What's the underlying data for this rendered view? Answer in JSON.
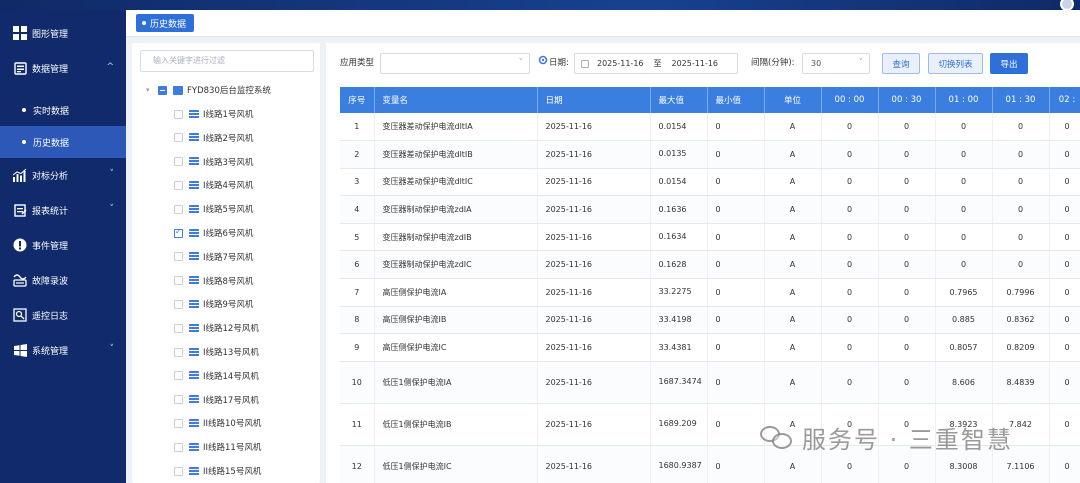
{
  "sidebar": {
    "items": [
      {
        "label": "图形管理",
        "icon": "grid-icon"
      },
      {
        "label": "数据管理",
        "icon": "database-icon",
        "expanded": true,
        "children": [
          {
            "label": "实时数据"
          },
          {
            "label": "历史数据",
            "active": true
          }
        ]
      },
      {
        "label": "对标分析",
        "icon": "bar-chart-icon"
      },
      {
        "label": "报表统计",
        "icon": "report-icon"
      },
      {
        "label": "事件管理",
        "icon": "alert-icon"
      },
      {
        "label": "故障录波",
        "icon": "wave-icon"
      },
      {
        "label": "遥控日志",
        "icon": "log-icon"
      },
      {
        "label": "系统管理",
        "icon": "windows-icon"
      }
    ]
  },
  "tab": {
    "label": "历史数据"
  },
  "tree": {
    "search_placeholder": "输入关键字进行过滤",
    "root": "FYD830后台监控系统",
    "nodes": [
      {
        "label": "I线路1号风机",
        "checked": false
      },
      {
        "label": "I线路2号风机",
        "checked": false
      },
      {
        "label": "I线路3号风机",
        "checked": false
      },
      {
        "label": "I线路4号风机",
        "checked": false
      },
      {
        "label": "I线路5号风机",
        "checked": false
      },
      {
        "label": "I线路6号风机",
        "checked": true
      },
      {
        "label": "I线路7号风机",
        "checked": false
      },
      {
        "label": "I线路8号风机",
        "checked": false
      },
      {
        "label": "I线路9号风机",
        "checked": false
      },
      {
        "label": "I线路12号风机",
        "checked": false
      },
      {
        "label": "I线路13号风机",
        "checked": false
      },
      {
        "label": "I线路14号风机",
        "checked": false
      },
      {
        "label": "I线路17号风机",
        "checked": false
      },
      {
        "label": "II线路10号风机",
        "checked": false
      },
      {
        "label": "II线路11号风机",
        "checked": false
      },
      {
        "label": "II线路15号风机",
        "checked": false
      }
    ]
  },
  "filters": {
    "app_type_label": "应用类型",
    "app_type_value": "",
    "date_label": "日期:",
    "date_from": "2025-11-16",
    "date_to_sep": "至",
    "date_to": "2025-11-16",
    "interval_label": "间隔(分钟):",
    "interval_value": "30",
    "query_button": "查询",
    "switch_button": "切换列表",
    "export_button": "导出"
  },
  "table": {
    "columns": [
      "序号",
      "变量名",
      "日期",
      "最大值",
      "最小值",
      "单位",
      "00 : 00",
      "00 : 30",
      "01 : 00",
      "01 : 30",
      "02 :"
    ],
    "rows": [
      [
        "1",
        "变压器差动保护电流dltIA",
        "2025-11-16",
        "0.0154",
        "0",
        "A",
        "0",
        "0",
        "0",
        "0",
        "0"
      ],
      [
        "2",
        "变压器差动保护电流dltIB",
        "2025-11-16",
        "0.0135",
        "0",
        "A",
        "0",
        "0",
        "0",
        "0",
        "0"
      ],
      [
        "3",
        "变压器差动保护电流dltIC",
        "2025-11-16",
        "0.0154",
        "0",
        "A",
        "0",
        "0",
        "0",
        "0",
        "0"
      ],
      [
        "4",
        "变压器制动保护电流zdIA",
        "2025-11-16",
        "0.1636",
        "0",
        "A",
        "0",
        "0",
        "0",
        "0",
        "0"
      ],
      [
        "5",
        "变压器制动保护电流zdIB",
        "2025-11-16",
        "0.1634",
        "0",
        "A",
        "0",
        "0",
        "0",
        "0",
        "0"
      ],
      [
        "6",
        "变压器制动保护电流zdIC",
        "2025-11-16",
        "0.1628",
        "0",
        "A",
        "0",
        "0",
        "0",
        "0",
        "0"
      ],
      [
        "7",
        "高压侧保护电流IA",
        "2025-11-16",
        "33.2275",
        "0",
        "A",
        "0",
        "0",
        "0.7965",
        "0.7996",
        "0"
      ],
      [
        "8",
        "高压侧保护电流IB",
        "2025-11-16",
        "33.4198",
        "0",
        "A",
        "0",
        "0",
        "0.885",
        "0.8362",
        "0"
      ],
      [
        "9",
        "高压侧保护电流IC",
        "2025-11-16",
        "33.4381",
        "0",
        "A",
        "0",
        "0",
        "0.8057",
        "0.8209",
        "0"
      ],
      [
        "10",
        "低压1侧保护电流IA",
        "2025-11-16",
        "1687.3474",
        "0",
        "A",
        "0",
        "0",
        "8.606",
        "8.4839",
        "0"
      ],
      [
        "11",
        "低压1侧保护电流IB",
        "2025-11-16",
        "1689.209",
        "0",
        "A",
        "0",
        "0",
        "8.3923",
        "7.842",
        "0"
      ],
      [
        "12",
        "低压1侧保护电流IC",
        "2025-11-16",
        "1680.9387",
        "0",
        "A",
        "0",
        "0",
        "8.3008",
        "7.1106",
        "0"
      ]
    ]
  },
  "watermark": {
    "text": "服务号 · 三重智慧"
  },
  "colors": {
    "sidebar": "#102a6b",
    "sidebar_active": "#2d58b8",
    "accent": "#2f6fd8",
    "table_header": "#3a7fe0"
  }
}
